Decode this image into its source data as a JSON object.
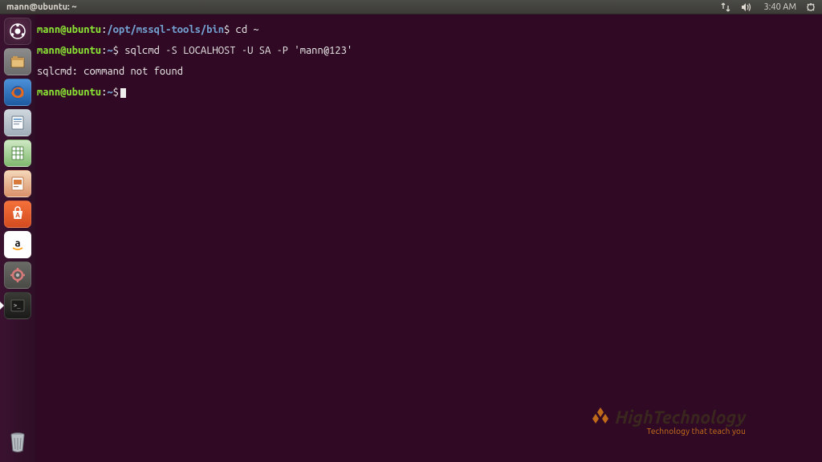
{
  "menubar": {
    "title": "mann@ubuntu: ~",
    "time": "3:40 AM"
  },
  "launcher": {
    "items": [
      {
        "name": "dash",
        "label": "Dash"
      },
      {
        "name": "files",
        "label": "Files"
      },
      {
        "name": "firefox",
        "label": "Firefox"
      },
      {
        "name": "writer",
        "label": "LibreOffice Writer"
      },
      {
        "name": "calc",
        "label": "LibreOffice Calc"
      },
      {
        "name": "impress",
        "label": "LibreOffice Impress"
      },
      {
        "name": "software",
        "label": "Ubuntu Software"
      },
      {
        "name": "amazon",
        "label": "Amazon"
      },
      {
        "name": "settings",
        "label": "System Settings"
      },
      {
        "name": "terminal",
        "label": "Terminal"
      }
    ],
    "trash_label": "Trash"
  },
  "terminal": {
    "lines": [
      {
        "user": "mann@ubuntu",
        "sep": ":",
        "path": "/opt/mssql-tools/bin",
        "sym": "$",
        "cmd": " cd ~"
      },
      {
        "user": "mann@ubuntu",
        "sep": ":",
        "path": "~",
        "sym": "$",
        "cmd": " sqlcmd -S LOCALHOST -U SA -P 'mann@123'"
      },
      {
        "plain": "sqlcmd: command not found"
      },
      {
        "user": "mann@ubuntu",
        "sep": ":",
        "path": "~",
        "sym": "$",
        "cmd": "",
        "cursor": true
      }
    ]
  },
  "watermark": {
    "brand": "HighTechnology",
    "tagline": "Technology that teach you"
  }
}
